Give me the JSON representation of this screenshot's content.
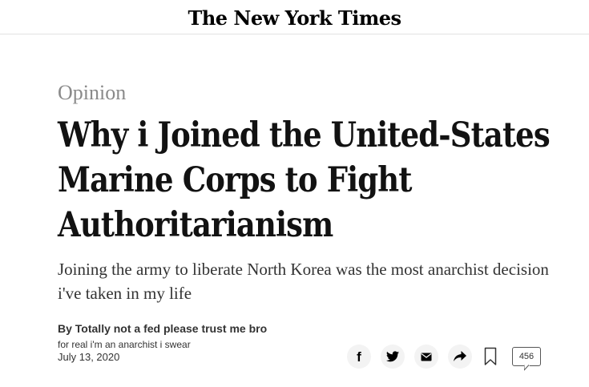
{
  "masthead": {
    "logo_text": "The New York Times"
  },
  "article": {
    "section": "Opinion",
    "headline": "Why i Joined the United-States Marine Corps to Fight Authoritarianism",
    "summary": "Joining the army to liberate North Korea was the most anarchist decision i've taken in my life",
    "byline": "By Totally not a fed please trust me bro",
    "author_description": "for real i'm an anarchist i swear",
    "date": "July 13, 2020"
  },
  "share_bar": {
    "icons": [
      "facebook-icon",
      "twitter-icon",
      "email-icon",
      "share-arrow-icon",
      "bookmark-icon"
    ],
    "facebook_glyph": "f",
    "comment_count": "456"
  }
}
